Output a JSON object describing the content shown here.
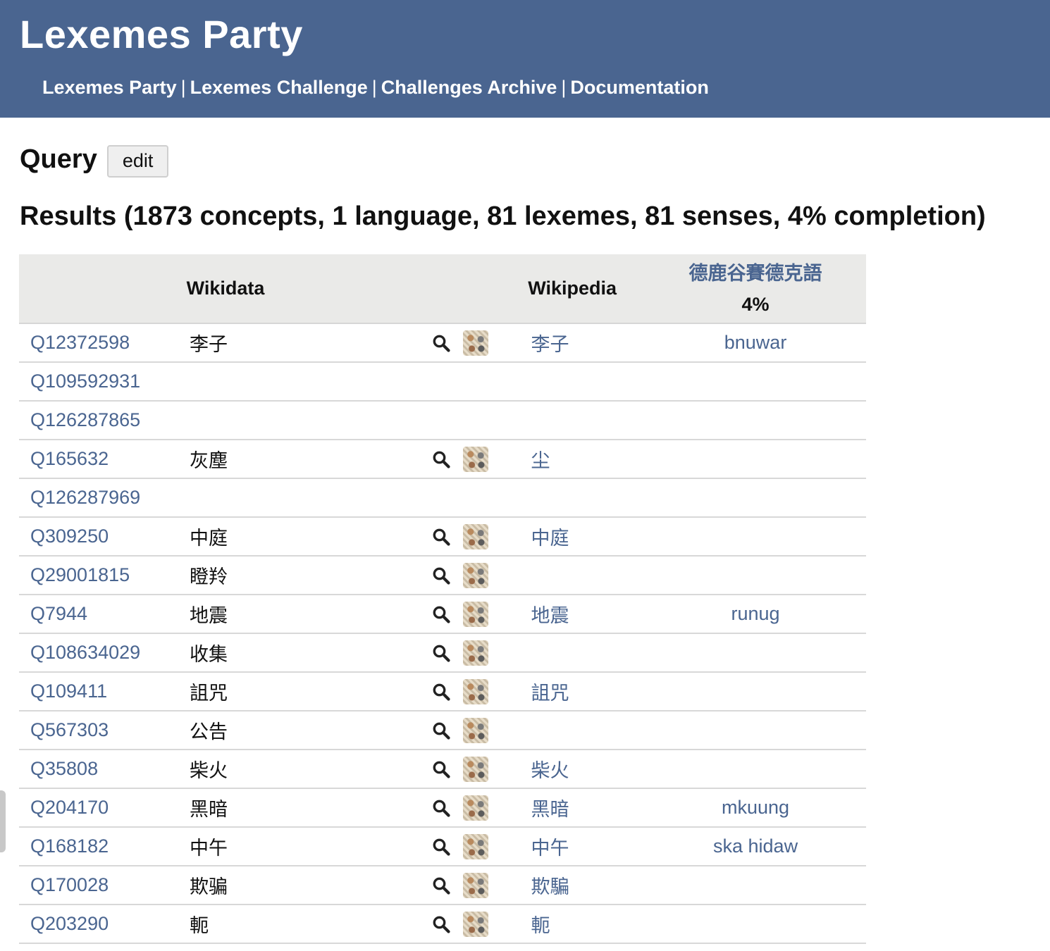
{
  "header": {
    "title": "Lexemes Party",
    "nav": [
      "Lexemes Party",
      "Lexemes Challenge",
      "Challenges Archive",
      "Documentation"
    ],
    "nav_separator": "|"
  },
  "query": {
    "title": "Query",
    "edit_label": "edit"
  },
  "results": {
    "title": "Results (1873 concepts, 1 language, 81 lexemes, 81 senses, 4% completion)",
    "columns": {
      "wikidata": "Wikidata",
      "wikipedia": "Wikipedia",
      "language": "德鹿谷賽德克語",
      "language_pct": "4%"
    },
    "rows": [
      {
        "qid": "Q12372598",
        "label": "李子",
        "tools": true,
        "wiki": "李子",
        "lexeme": "bnuwar"
      },
      {
        "qid": "Q109592931",
        "label": "",
        "tools": false,
        "wiki": "",
        "lexeme": ""
      },
      {
        "qid": "Q126287865",
        "label": "",
        "tools": false,
        "wiki": "",
        "lexeme": ""
      },
      {
        "qid": "Q165632",
        "label": "灰塵",
        "tools": true,
        "wiki": "尘",
        "lexeme": ""
      },
      {
        "qid": "Q126287969",
        "label": "",
        "tools": false,
        "wiki": "",
        "lexeme": ""
      },
      {
        "qid": "Q309250",
        "label": "中庭",
        "tools": true,
        "wiki": "中庭",
        "lexeme": ""
      },
      {
        "qid": "Q29001815",
        "label": "瞪羚",
        "tools": true,
        "wiki": "",
        "lexeme": ""
      },
      {
        "qid": "Q7944",
        "label": "地震",
        "tools": true,
        "wiki": "地震",
        "lexeme": "runug"
      },
      {
        "qid": "Q108634029",
        "label": "收集",
        "tools": true,
        "wiki": "",
        "lexeme": ""
      },
      {
        "qid": "Q109411",
        "label": "詛咒",
        "tools": true,
        "wiki": "詛咒",
        "lexeme": ""
      },
      {
        "qid": "Q567303",
        "label": "公告",
        "tools": true,
        "wiki": "",
        "lexeme": ""
      },
      {
        "qid": "Q35808",
        "label": "柴火",
        "tools": true,
        "wiki": "柴火",
        "lexeme": ""
      },
      {
        "qid": "Q204170",
        "label": "黑暗",
        "tools": true,
        "wiki": "黑暗",
        "lexeme": "mkuung"
      },
      {
        "qid": "Q168182",
        "label": "中午",
        "tools": true,
        "wiki": "中午",
        "lexeme": "ska hidaw"
      },
      {
        "qid": "Q170028",
        "label": "欺骗",
        "tools": true,
        "wiki": "欺騙",
        "lexeme": ""
      },
      {
        "qid": "Q203290",
        "label": "軛",
        "tools": true,
        "wiki": "軛",
        "lexeme": ""
      }
    ]
  },
  "colors": {
    "header_bg": "#4a6590",
    "link": "#4a6590",
    "table_head_bg": "#eaeae8"
  },
  "icons": {
    "search": "search-icon",
    "reasonator": "reasonator-icon"
  }
}
